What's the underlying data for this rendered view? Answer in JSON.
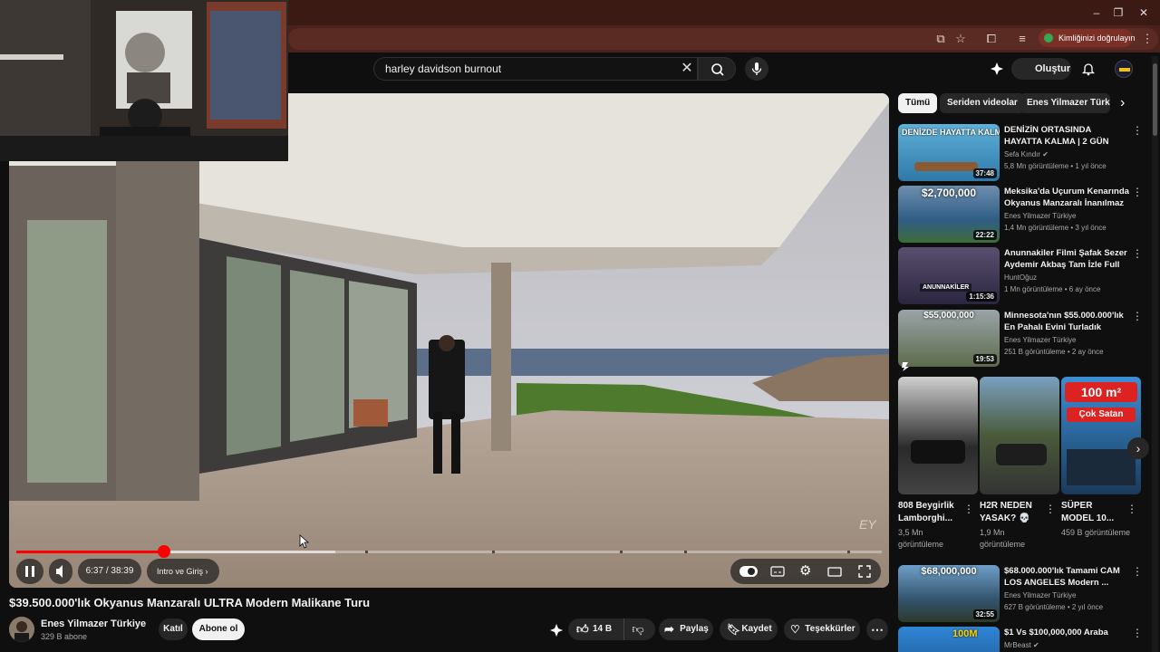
{
  "browser": {
    "verify_label": "Kimliğinizi doğrulayın"
  },
  "search": {
    "query": "harley davidson burnout"
  },
  "header": {
    "create_label": "Oluştur"
  },
  "player": {
    "time": "6:37 / 38:39",
    "chapter": "Intro ve Giriş",
    "watermark": "EY",
    "progress_fraction": 0.171
  },
  "video": {
    "title": "$39.500.000'lık Okyanus Manzaralı ULTRA Modern Malikane Turu",
    "channel": "Enes Yilmazer Türkiye",
    "subscribers": "329 B abone",
    "join_label": "Katıl",
    "subscribe_label": "Abone ol",
    "likes": "14 B",
    "share_label": "Paylaş",
    "save_label": "Kaydet",
    "thanks_label": "Teşekkürler"
  },
  "chips": [
    "Tümü",
    "Seriden videolar",
    "Enes Yilmazer Türkiye"
  ],
  "recommendations": [
    {
      "title": "DENİZİN ORTASINDA HAYATTA KALMA | 2 GÜN",
      "channel": "Sefa Kındır",
      "meta": "5,8 Mn görüntüleme • 1 yıl önce",
      "duration": "37:48",
      "overlay": "DENİZDE HAYATTA KALMA"
    },
    {
      "title": "Meksika'da Uçurum Kenarında Okyanus Manzaralı İnanılmaz ...",
      "channel": "Enes Yilmazer Türkiye",
      "meta": "1,4 Mn görüntüleme • 3 yıl önce",
      "duration": "22:22",
      "overlay": "$2,700,000"
    },
    {
      "title": "Anunnakiler Filmi Şafak Sezer Aydemir Akbaş Tam İzle Full H...",
      "channel": "HuntOğuz",
      "meta": "1 Mn görüntüleme • 6 ay önce",
      "duration": "1:15:36",
      "overlay": "ANUNNAKİLER"
    },
    {
      "title": "Minnesota'nın $55.000.000'lık En Pahalı Evini Turladık",
      "channel": "Enes Yilmazer Türkiye",
      "meta": "251 B görüntüleme • 2 ay önce",
      "duration": "19:53",
      "overlay": "$55,000,000"
    }
  ],
  "shorts": [
    {
      "title": "808 Beygirlik Lamborghi...",
      "views": "3,5 Mn görüntüleme"
    },
    {
      "title": "H2R NEDEN YASAK? 💀",
      "views": "1,9 Mn görüntüleme"
    },
    {
      "title": "SÜPER MODEL 10...",
      "views": "459 B görüntüleme",
      "overlay_1": "100 m²",
      "overlay_2": "Çok Satan"
    }
  ],
  "recommendations_2": [
    {
      "title": "$68.000.000'lık Tamami CAM LOS ANGELES Modern ...",
      "channel": "Enes Yilmazer Türkiye",
      "meta": "627 B görüntüleme • 2 yıl önce",
      "duration": "32:55",
      "overlay": "$68,000,000"
    },
    {
      "title": "$1 Vs $100,000,000 Araba",
      "channel": "MrBeast",
      "overlay": "100M"
    }
  ],
  "colors": {
    "accent": "#ff0000",
    "chrome": "#4a221b",
    "bg": "#0f0f0f"
  }
}
